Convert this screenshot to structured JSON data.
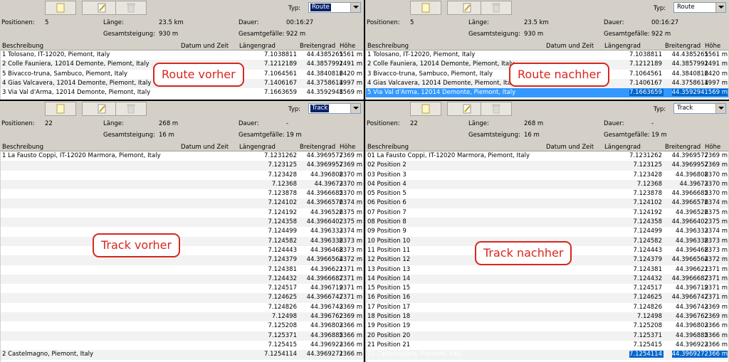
{
  "labels": {
    "typ": "Typ:",
    "positions": "Positionen:",
    "length": "Länge:",
    "duration": "Dauer:",
    "ascent": "Gesamtsteigung:",
    "descent": "Gesamtgefälle:",
    "col_desc": "Beschreibung",
    "col_datetime": "Datum und Zeit",
    "col_long": "Längengrad",
    "col_lat": "Breitengrad",
    "col_height": "Höhe"
  },
  "toolbar_icons": [
    "new-document-icon",
    "edit-icon",
    "delete-icon"
  ],
  "colors": {
    "callout": "#d9261c",
    "selection": "#3399ff",
    "panel": "#d4d0c8"
  },
  "panels": [
    {
      "id": "route_before",
      "type": "Route",
      "positions": "5",
      "length": "23.5 km",
      "duration": "00:16:27",
      "ascent": "930 m",
      "descent": "922 m",
      "callout": "Route vorher",
      "rows": [
        [
          "1 Tolosano, IT-12020, Piemont, Italy",
          "7.1038811",
          "44.4385265",
          "1561 m"
        ],
        [
          "2 Colle Fauniera, 12014 Demonte, Piemont, Italy",
          "7.1212189",
          "44.3857991",
          "2491 m"
        ],
        [
          "5 Bivacco-truna, Sambuco, Piemont, Italy",
          "7.1064561",
          "44.3840816",
          "2420 m"
        ],
        [
          "4 Gias Valcavera, 12014 Demonte, Piemont, Italy",
          "7.1406167",
          "44.3758614",
          "1997 m"
        ],
        [
          "3 Via Val d'Arma, 12014 Demonte, Piemont, Italy",
          "7.1663659",
          "44.3592948",
          "1569 m"
        ]
      ]
    },
    {
      "id": "route_after",
      "type": "Route",
      "positions": "5",
      "length": "23.5 km",
      "duration": "00:16:27",
      "ascent": "930 m",
      "descent": "922 m",
      "callout": "Route nachher",
      "rows": [
        [
          "1 Tolosano, IT-12020, Piemont, Italy",
          "7.1038811",
          "44.4385265",
          "1561 m"
        ],
        [
          "2 Colle Fauniera, 12014 Demonte, Piemont, Italy",
          "7.1212189",
          "44.3857991",
          "2491 m"
        ],
        [
          "3 Bivacco-truna, Sambuco, Piemont, Italy",
          "7.1064561",
          "44.3840816",
          "2420 m"
        ],
        [
          "4 Gias Valcavera, 12014 Demonte, Piemont, Italy",
          "7.1406167",
          "44.3758614",
          "1997 m"
        ],
        [
          "5 Via Val d'Arma, 12014 Demonte, Piemont, Italy",
          "7.1663659",
          "44.3592948",
          "1569 m"
        ]
      ]
    },
    {
      "id": "track_before",
      "type": "Track",
      "positions": "22",
      "length": "268 m",
      "duration": "-",
      "ascent": "16 m",
      "descent": "19 m",
      "callout": "Track vorher",
      "rows": [
        [
          "1 La Fausto Coppi, IT-12020 Marmora, Piemont, Italy",
          "7.1231262",
          "44.3969577",
          "2369 m"
        ],
        [
          "",
          "7.123125",
          "44.3969957",
          "2369 m"
        ],
        [
          "",
          "7.123428",
          "44.396808",
          "2370 m"
        ],
        [
          "",
          "7.12368",
          "44.39673",
          "2370 m"
        ],
        [
          "",
          "7.123878",
          "44.3966685",
          "2370 m"
        ],
        [
          "",
          "7.124102",
          "44.3966576",
          "2374 m"
        ],
        [
          "",
          "7.124192",
          "44.396526",
          "2375 m"
        ],
        [
          "",
          "7.124358",
          "44.3966402",
          "2375 m"
        ],
        [
          "",
          "7.124499",
          "44.396333",
          "2374 m"
        ],
        [
          "",
          "7.124582",
          "44.396338",
          "2373 m"
        ],
        [
          "",
          "7.124443",
          "44.396468",
          "2373 m"
        ],
        [
          "",
          "7.124379",
          "44.3966564",
          "2372 m"
        ],
        [
          "",
          "7.124381",
          "44.396621",
          "2371 m"
        ],
        [
          "",
          "7.124432",
          "44.3966687",
          "2371 m"
        ],
        [
          "",
          "7.124517",
          "44.396719",
          "2371 m"
        ],
        [
          "",
          "7.124625",
          "44.3966747",
          "2371 m"
        ],
        [
          "",
          "7.124826",
          "44.396743",
          "2369 m"
        ],
        [
          "",
          "7.12498",
          "44.396762",
          "2369 m"
        ],
        [
          "",
          "7.125208",
          "44.396803",
          "2366 m"
        ],
        [
          "",
          "7.125371",
          "44.396885",
          "2366 m"
        ],
        [
          "",
          "7.125415",
          "44.396923",
          "2366 m"
        ],
        [
          "2 Castelmagno, Piemont, Italy",
          "7.1254114",
          "44.3969271",
          "2366 m"
        ]
      ]
    },
    {
      "id": "track_after",
      "type": "Track",
      "positions": "22",
      "length": "268 m",
      "duration": "-",
      "ascent": "16 m",
      "descent": "19 m",
      "callout": "Track nachher",
      "rows": [
        [
          "01 La Fausto Coppi, IT-12020 Marmora, Piemont, Italy",
          "7.1231262",
          "44.3969577",
          "2369 m"
        ],
        [
          "02 Position 2",
          "7.123125",
          "44.3969957",
          "2369 m"
        ],
        [
          "03 Position 3",
          "7.123428",
          "44.396808",
          "2370 m"
        ],
        [
          "04 Position 4",
          "7.12368",
          "44.39673",
          "2370 m"
        ],
        [
          "05 Position 5",
          "7.123878",
          "44.3966685",
          "2370 m"
        ],
        [
          "06 Position 6",
          "7.124102",
          "44.3966576",
          "2374 m"
        ],
        [
          "07 Position 7",
          "7.124192",
          "44.396526",
          "2375 m"
        ],
        [
          "08 Position 8",
          "7.124358",
          "44.3966402",
          "2375 m"
        ],
        [
          "09 Position 9",
          "7.124499",
          "44.396333",
          "2374 m"
        ],
        [
          "10 Position 10",
          "7.124582",
          "44.396338",
          "2373 m"
        ],
        [
          "11 Position 11",
          "7.124443",
          "44.396468",
          "2373 m"
        ],
        [
          "12 Position 12",
          "7.124379",
          "44.3966564",
          "2372 m"
        ],
        [
          "13 Position 13",
          "7.124381",
          "44.396621",
          "2371 m"
        ],
        [
          "14 Position 14",
          "7.124432",
          "44.3966687",
          "2371 m"
        ],
        [
          "15 Position 15",
          "7.124517",
          "44.396719",
          "2371 m"
        ],
        [
          "16 Position 16",
          "7.124625",
          "44.3966747",
          "2371 m"
        ],
        [
          "17 Position 17",
          "7.124826",
          "44.396743",
          "2369 m"
        ],
        [
          "18 Position 18",
          "7.12498",
          "44.396762",
          "2369 m"
        ],
        [
          "19 Position 19",
          "7.125208",
          "44.396803",
          "2366 m"
        ],
        [
          "20 Position 20",
          "7.125371",
          "44.396885",
          "2366 m"
        ],
        [
          "21 Position 21",
          "7.125415",
          "44.396923",
          "2366 m"
        ],
        [
          "22 Castelmagno, Piemont, Italy",
          "7.1254114",
          "44.3969271",
          "2366 m"
        ]
      ]
    }
  ]
}
